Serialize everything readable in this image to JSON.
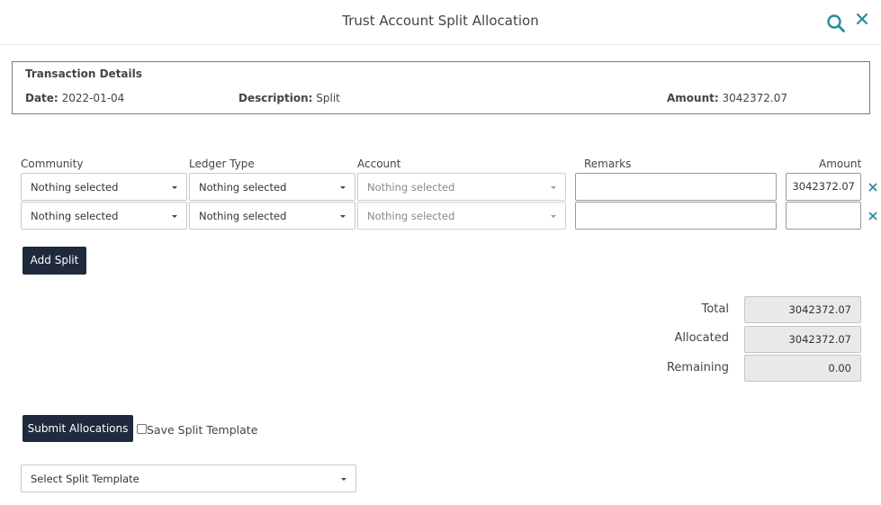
{
  "header": {
    "title": "Trust Account Split Allocation"
  },
  "details": {
    "title": "Transaction Details",
    "date_label": "Date:",
    "date_value": "2022-01-04",
    "description_label": "Description:",
    "description_value": "Split",
    "amount_label": "Amount:",
    "amount_value": "3042372.07"
  },
  "columns": {
    "community": "Community",
    "ledger_type": "Ledger Type",
    "account": "Account",
    "remarks": "Remarks",
    "amount": "Amount"
  },
  "rows": [
    {
      "community": "Nothing selected",
      "ledger_type": "Nothing selected",
      "account": "Nothing selected",
      "remarks": "",
      "amount": "3042372.07"
    },
    {
      "community": "Nothing selected",
      "ledger_type": "Nothing selected",
      "account": "Nothing selected",
      "remarks": "",
      "amount": ""
    }
  ],
  "buttons": {
    "add_split": "Add Split",
    "submit": "Submit Allocations"
  },
  "summary": {
    "total_label": "Total",
    "total_value": "3042372.07",
    "allocated_label": "Allocated",
    "allocated_value": "3042372.07",
    "remaining_label": "Remaining",
    "remaining_value": "0.00"
  },
  "template": {
    "save_label": "Save Split Template",
    "select_placeholder": "Select Split Template"
  },
  "icons": {
    "search": "search-icon",
    "close": "close-icon",
    "remove_row": "close-icon",
    "dropdown": "caret-down-icon"
  },
  "colors": {
    "accent": "#2a8aa0",
    "button_dark": "#1f2a3d"
  }
}
